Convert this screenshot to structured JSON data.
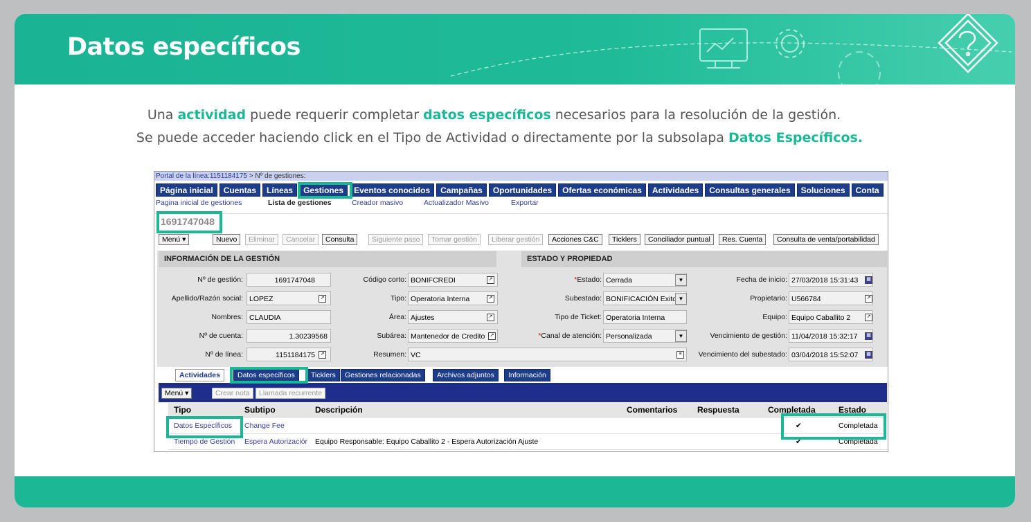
{
  "header": {
    "title": "Datos específicos"
  },
  "intro": {
    "line1_a": "Una ",
    "line1_b": "actividad",
    "line1_c": " puede requerir completar ",
    "line1_d": "datos específicos",
    "line1_e": " necesarios para la resolución de la gestión.",
    "line2_a": "Se puede acceder haciendo click en el Tipo de Actividad o directamente por la subsolapa ",
    "line2_b": "Datos Específicos."
  },
  "app": {
    "breadcrumb_link": "Portal de la línea:1151184175",
    "breadcrumb_rest": "  > Nº de gestiones:",
    "menu": [
      "Página inicial",
      "Cuentas",
      "Líneas",
      "Gestiones",
      "Eventos conocidos",
      "Campañas",
      "Oportunidades",
      "Ofertas económicas",
      "Actividades",
      "Consultas generales",
      "Soluciones",
      "Conta"
    ],
    "submenu": [
      "Pagina inicial de gestiones",
      "Lista de gestiones",
      "Creador masivo",
      "Actualizador Masivo",
      "Exportar"
    ],
    "record_id": "1691747048",
    "toolbar": [
      "Menú ▾",
      "Nuevo",
      "Eliminar",
      "Cancelar",
      "Consulta",
      "Siguiente paso",
      "Tomar gestión",
      "Liberar gestión",
      "Acciones C&C",
      "Ticklers",
      "Conciliador puntual",
      "Res. Cuenta",
      "Consulta de venta/portabilidad"
    ],
    "section_info": "INFORMACIÓN DE LA GESTIÓN",
    "section_state": "ESTADO Y PROPIEDAD",
    "fields": {
      "nro_gestion_label": "Nº de gestión:",
      "nro_gestion": "1691747048",
      "apellido_label": "Apellido/Razón social:",
      "apellido": "LOPEZ",
      "nombres_label": "Nombres:",
      "nombres": "CLAUDIA",
      "cuenta_label": "Nº de cuenta:",
      "cuenta": "1.30239568",
      "linea_label": "Nº de línea:",
      "linea": "1151184175",
      "codigo_label": "Código corto:",
      "codigo": "BONIFCREDI",
      "tipo_label": "Tipo:",
      "tipo": "Operatoria Interna",
      "area_label": "Área:",
      "area": "Ajustes",
      "subarea_label": "Subárea:",
      "subarea": "Mantenedor de Credito",
      "resumen_label": "Resumen:",
      "resumen": "VC",
      "estado_label": "Estado:",
      "estado": "Cerrada",
      "subestado_label": "Subestado:",
      "subestado": "BONIFICACIÓN Exito",
      "ticket_label": "Tipo de Ticket:",
      "ticket": "Operatoria Interna",
      "canal_label": "Canal de atención:",
      "canal": "Personalizada",
      "inicio_label": "Fecha de inicio:",
      "inicio": "27/03/2018 15:31:43",
      "propietario_label": "Propietario:",
      "propietario": "U566784",
      "equipo_label": "Equipo:",
      "equipo": "Equipo Caballito 2",
      "venc_label": "Vencimiento de gestión:",
      "venc": "11/04/2018 15:32:17",
      "vencsub_label": "Vencimiento del subestado:",
      "vencsub": "03/04/2018 15:52:07"
    },
    "tabs": [
      "Actividades",
      "Datos específicos",
      "Ticklers",
      "Gestiones relacionadas",
      "Archivos adjuntos",
      "Información"
    ],
    "grid_tools": [
      "Menú ▾",
      "Crear nota",
      "Llamada recurrente"
    ],
    "columns": [
      "Tipo",
      "Subtipo",
      "Descripción",
      "Comentarios",
      "Respuesta",
      "Completada",
      "Estado"
    ],
    "rows": [
      {
        "tipo": "Datos Específicos",
        "subtipo": "Change Fee",
        "descripcion": "",
        "check": "✔",
        "estado": "Completada"
      },
      {
        "tipo": "Tiempo de Gestión",
        "subtipo": "Espera Autorizaciór",
        "descripcion": "Equipo Responsable: Equipo Caballito 2 - Espera Autorización Ajuste",
        "check": "✔",
        "estado": "Completada"
      }
    ]
  }
}
